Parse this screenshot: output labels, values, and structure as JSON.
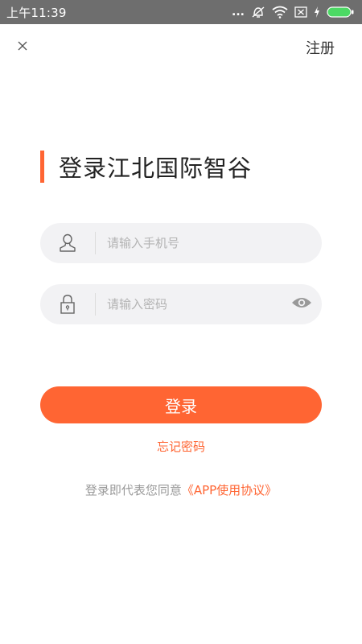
{
  "status_bar": {
    "time": "上午11:39",
    "dots": "..."
  },
  "header": {
    "close_glyph": "×",
    "register_label": "注册"
  },
  "title": "登录江北国际智谷",
  "form": {
    "phone_placeholder": "请输入手机号",
    "phone_value": "",
    "password_placeholder": "请输入密码",
    "password_value": ""
  },
  "actions": {
    "login_label": "登录",
    "forgot_label": "忘记密码"
  },
  "agreement": {
    "prefix": "登录即代表您同意",
    "link_text": "《APP使用协议》"
  },
  "icons": {
    "close": "close-icon",
    "user": "user-icon",
    "lock": "lock-icon",
    "eye": "eye-icon",
    "battery": "battery-icon",
    "wifi": "wifi-icon",
    "sim": "sim-icon",
    "charging": "charging-icon",
    "alarm": "alarm-off-icon"
  },
  "colors": {
    "accent": "#ff6533",
    "status_bar": "#6e6e6e",
    "field_bg": "#f2f2f4",
    "battery": "#4cd964"
  }
}
